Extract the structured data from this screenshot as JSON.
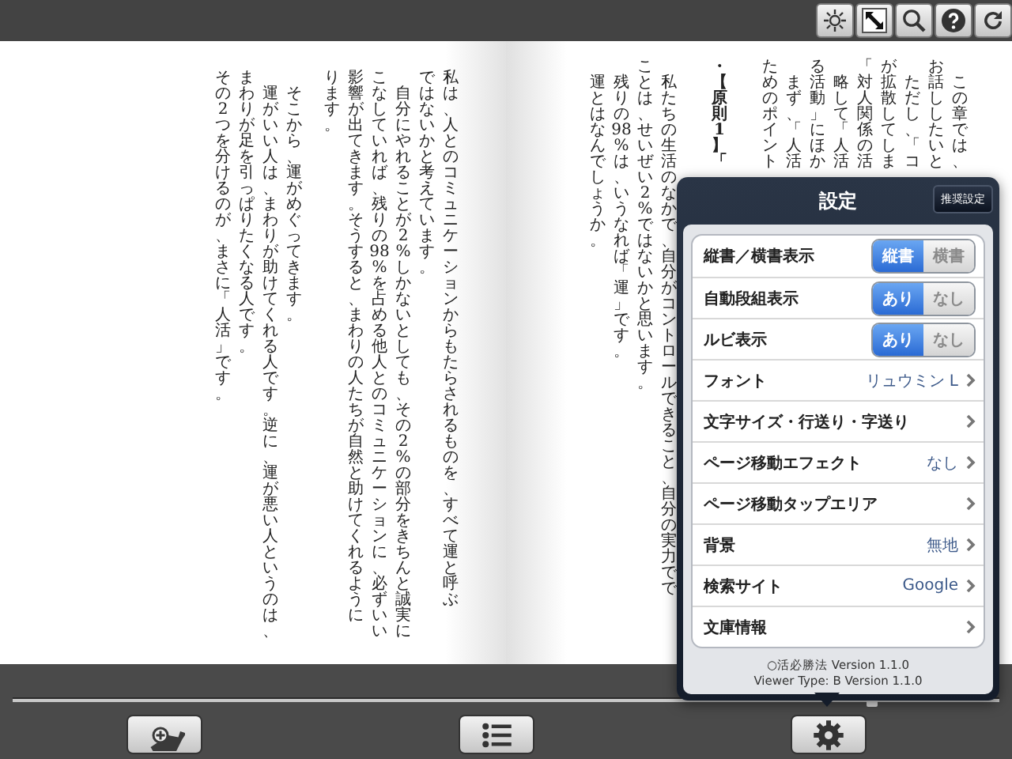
{
  "top_toolbar": {
    "buttons": [
      {
        "kind": "brightness"
      },
      {
        "kind": "fullscreen"
      },
      {
        "kind": "search"
      },
      {
        "kind": "help"
      },
      {
        "kind": "refresh"
      }
    ]
  },
  "left_page": {
    "sections": [
      {
        "columns": [
          {
            "kind": "text",
            "text": "その2つを分けるのが、まさに「人活」です。"
          },
          {
            "kind": "text",
            "text": "まわりが足を引っぱりたくなる人です。"
          },
          {
            "kind": "text",
            "text": "　運がいい人は、まわりが助けてくれる人です。逆に、運が悪い人というのは、"
          },
          {
            "kind": "text",
            "text": "　そこから、運がめぐってきます。"
          }
        ]
      },
      {
        "columns": [
          {
            "kind": "text",
            "text": "ります。"
          },
          {
            "kind": "text",
            "text": "影響が出てきます。そうすると、まわりの人たちが自然と助けてくれるように"
          },
          {
            "kind": "text",
            "text": "こなしていれば、残りの98%を占める他人とのコミュニケーションに、必ずいい"
          },
          {
            "kind": "text",
            "text": "　自分にやれることが2%しかないとしても、その2%の部分をきちんと誠実に"
          },
          {
            "kind": "text",
            "text": "ではないかと考えています。"
          },
          {
            "kind": "text",
            "text": "私は、人とのコミュニケーションからもたらされるものを、すべて運と呼ぶ"
          }
        ]
      }
    ]
  },
  "right_page": {
    "sections": [
      {
        "columns": [
          {
            "kind": "text",
            "text": "　運とはなんでしょうか。"
          },
          {
            "kind": "text",
            "text": "　残りの98%は、いうなれば「運」です。"
          },
          {
            "kind": "text",
            "text": "ことは、せいぜい2%ではないかと思います。"
          },
          {
            "kind": "text",
            "text": "　私たちの生活のなかで、自分がコントロールできること、自分の実力でで"
          }
        ]
      },
      {
        "columns": [
          {
            "kind": "heading",
            "text": "・【原則1】「"
          }
        ]
      },
      {
        "columns": [
          {
            "kind": "text",
            "text": "ためのポイント"
          },
          {
            "kind": "text",
            "text": "　まず、「人活"
          },
          {
            "kind": "text",
            "text": "る活動」にほか"
          },
          {
            "kind": "text",
            "text": "　略して「人活"
          },
          {
            "kind": "text",
            "text": "「対人関係の活"
          },
          {
            "kind": "text",
            "text": "が拡散してしま"
          },
          {
            "kind": "text",
            "text": "　ただし、「コ"
          },
          {
            "kind": "text",
            "text": "お話ししたいと"
          },
          {
            "kind": "text",
            "text": "　この章では、"
          }
        ]
      }
    ]
  },
  "settings": {
    "title": "設定",
    "preset_button": "推奨設定",
    "rows": [
      {
        "kind": "segmented",
        "label": "縦書／横書表示",
        "options": [
          {
            "label": "縦書",
            "selected": true
          },
          {
            "label": "横書",
            "selected": false
          }
        ]
      },
      {
        "kind": "segmented",
        "label": "自動段組表示",
        "options": [
          {
            "label": "あり",
            "selected": true
          },
          {
            "label": "なし",
            "selected": false
          }
        ]
      },
      {
        "kind": "segmented",
        "label": "ルビ表示",
        "options": [
          {
            "label": "あり",
            "selected": true
          },
          {
            "label": "なし",
            "selected": false
          }
        ]
      },
      {
        "kind": "link",
        "label": "フォント",
        "value": "リュウミン L"
      },
      {
        "kind": "link",
        "label": "文字サイズ・行送り・字送り"
      },
      {
        "kind": "link",
        "label": "ページ移動エフェクト",
        "value": "なし"
      },
      {
        "kind": "link",
        "label": "ページ移動タップエリア"
      },
      {
        "kind": "link",
        "label": "背景",
        "value": "無地"
      },
      {
        "kind": "link",
        "label": "検索サイト",
        "value": "Google"
      },
      {
        "kind": "link",
        "label": "文庫情報"
      }
    ],
    "footer": [
      "○活必勝法 Version 1.1.0",
      "Viewer Type: B Version 1.1.0"
    ]
  },
  "bottom_toolbar": {
    "page_slider": {
      "level": 0.87
    },
    "buttons": [
      {
        "kind": "bookmark"
      },
      {
        "kind": "contents"
      },
      {
        "kind": "settings"
      }
    ]
  }
}
